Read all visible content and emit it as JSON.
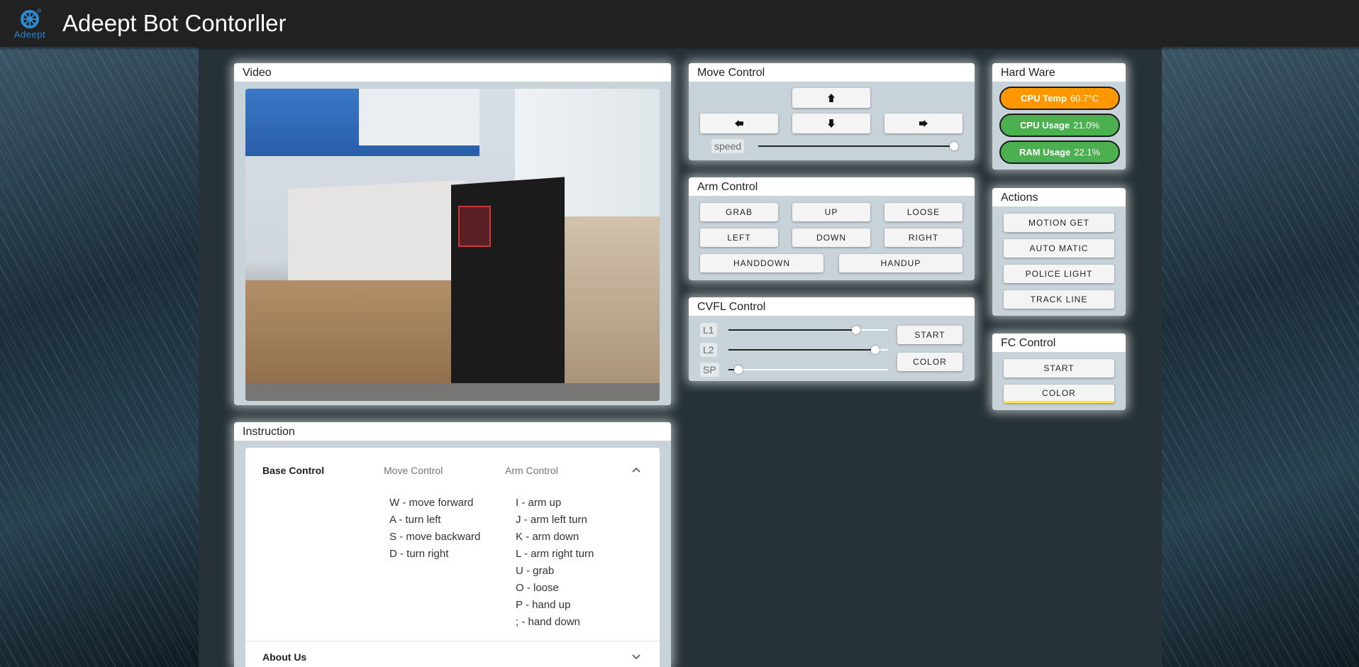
{
  "app": {
    "title": "Adeept Bot Contorller",
    "logo_text": "Adeept"
  },
  "colors": {
    "topbar": "#212121",
    "card_body": "#c8d3d9",
    "cpu_temp": "#ff9800",
    "cpu_usage": "#4caf50",
    "ram_usage": "#4caf50",
    "accent_yellow": "#ffeb3b",
    "logo_blue": "#2a8ad4"
  },
  "video": {
    "title": "Video"
  },
  "instruction": {
    "title": "Instruction",
    "tabs": [
      "Base Control",
      "Move Control",
      "Arm Control"
    ],
    "move_list": [
      "W - move forward",
      "A - turn left",
      "S - move backward",
      "D - turn right"
    ],
    "arm_list": [
      "I - arm up",
      "J - arm left turn",
      "K - arm down",
      "L - arm right turn",
      "U - grab",
      "O - loose",
      "P - hand up",
      "; - hand down"
    ],
    "about": "About Us"
  },
  "move_control": {
    "title": "Move Control",
    "icons": [
      "arrow-up-icon",
      "arrow-left-icon",
      "arrow-down-icon",
      "arrow-right-icon"
    ],
    "speed_label": "speed",
    "speed_value": 1.0
  },
  "arm_control": {
    "title": "Arm Control",
    "buttons": [
      "GRAB",
      "UP",
      "LOOSE",
      "LEFT",
      "DOWN",
      "RIGHT",
      "HANDDOWN",
      "HANDUP"
    ]
  },
  "cvfl_control": {
    "title": "CVFL Control",
    "sliders": [
      {
        "label": "L1",
        "value": 0.8
      },
      {
        "label": "L2",
        "value": 0.92
      },
      {
        "label": "SP",
        "value": 0.06
      }
    ],
    "start": "START",
    "color": "COLOR"
  },
  "hardware": {
    "title": "Hard Ware",
    "cpu_temp_label": "CPU Temp",
    "cpu_temp_value": "60.7°C",
    "cpu_usage_label": "CPU Usage",
    "cpu_usage_value": "21.0%",
    "ram_usage_label": "RAM Usage",
    "ram_usage_value": "22.1%"
  },
  "actions": {
    "title": "Actions",
    "buttons": [
      "MOTION GET",
      "AUTO MATIC",
      "POLICE LIGHT",
      "TRACK LINE"
    ]
  },
  "fc_control": {
    "title": "FC Control",
    "start": "START",
    "color": "COLOR"
  }
}
